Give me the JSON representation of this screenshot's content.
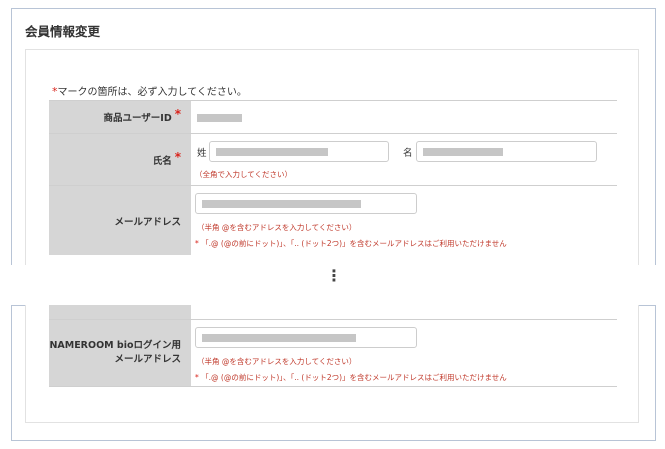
{
  "page": {
    "title": "会員情報変更",
    "required_note": "マークの箇所は、必ず入力してください。",
    "required_mark": "*"
  },
  "fields": {
    "user_id": {
      "label": "商品ユーザーID"
    },
    "name": {
      "label": "氏名",
      "last_name_label": "姓",
      "first_name_label": "名",
      "hint": "（全角で入力してください）"
    },
    "email": {
      "label": "メールアドレス",
      "hint": "（半角 @を含むアドレスを入力してください）",
      "warning": "「.@ (@の前にドット)」、「.. (ドット2つ)」を含むメールアドレスはご利用いただけません"
    },
    "nameroom_email": {
      "label_line1": "NAMEROOM bioログイン用",
      "label_line2": "メールアドレス",
      "hint": "（半角 @を含むアドレスを入力してください）",
      "warning": "「.@ (@の前にドット)」、「.. (ドット2つ)」を含むメールアドレスはご利用いただけません"
    }
  },
  "separator": "⋮"
}
